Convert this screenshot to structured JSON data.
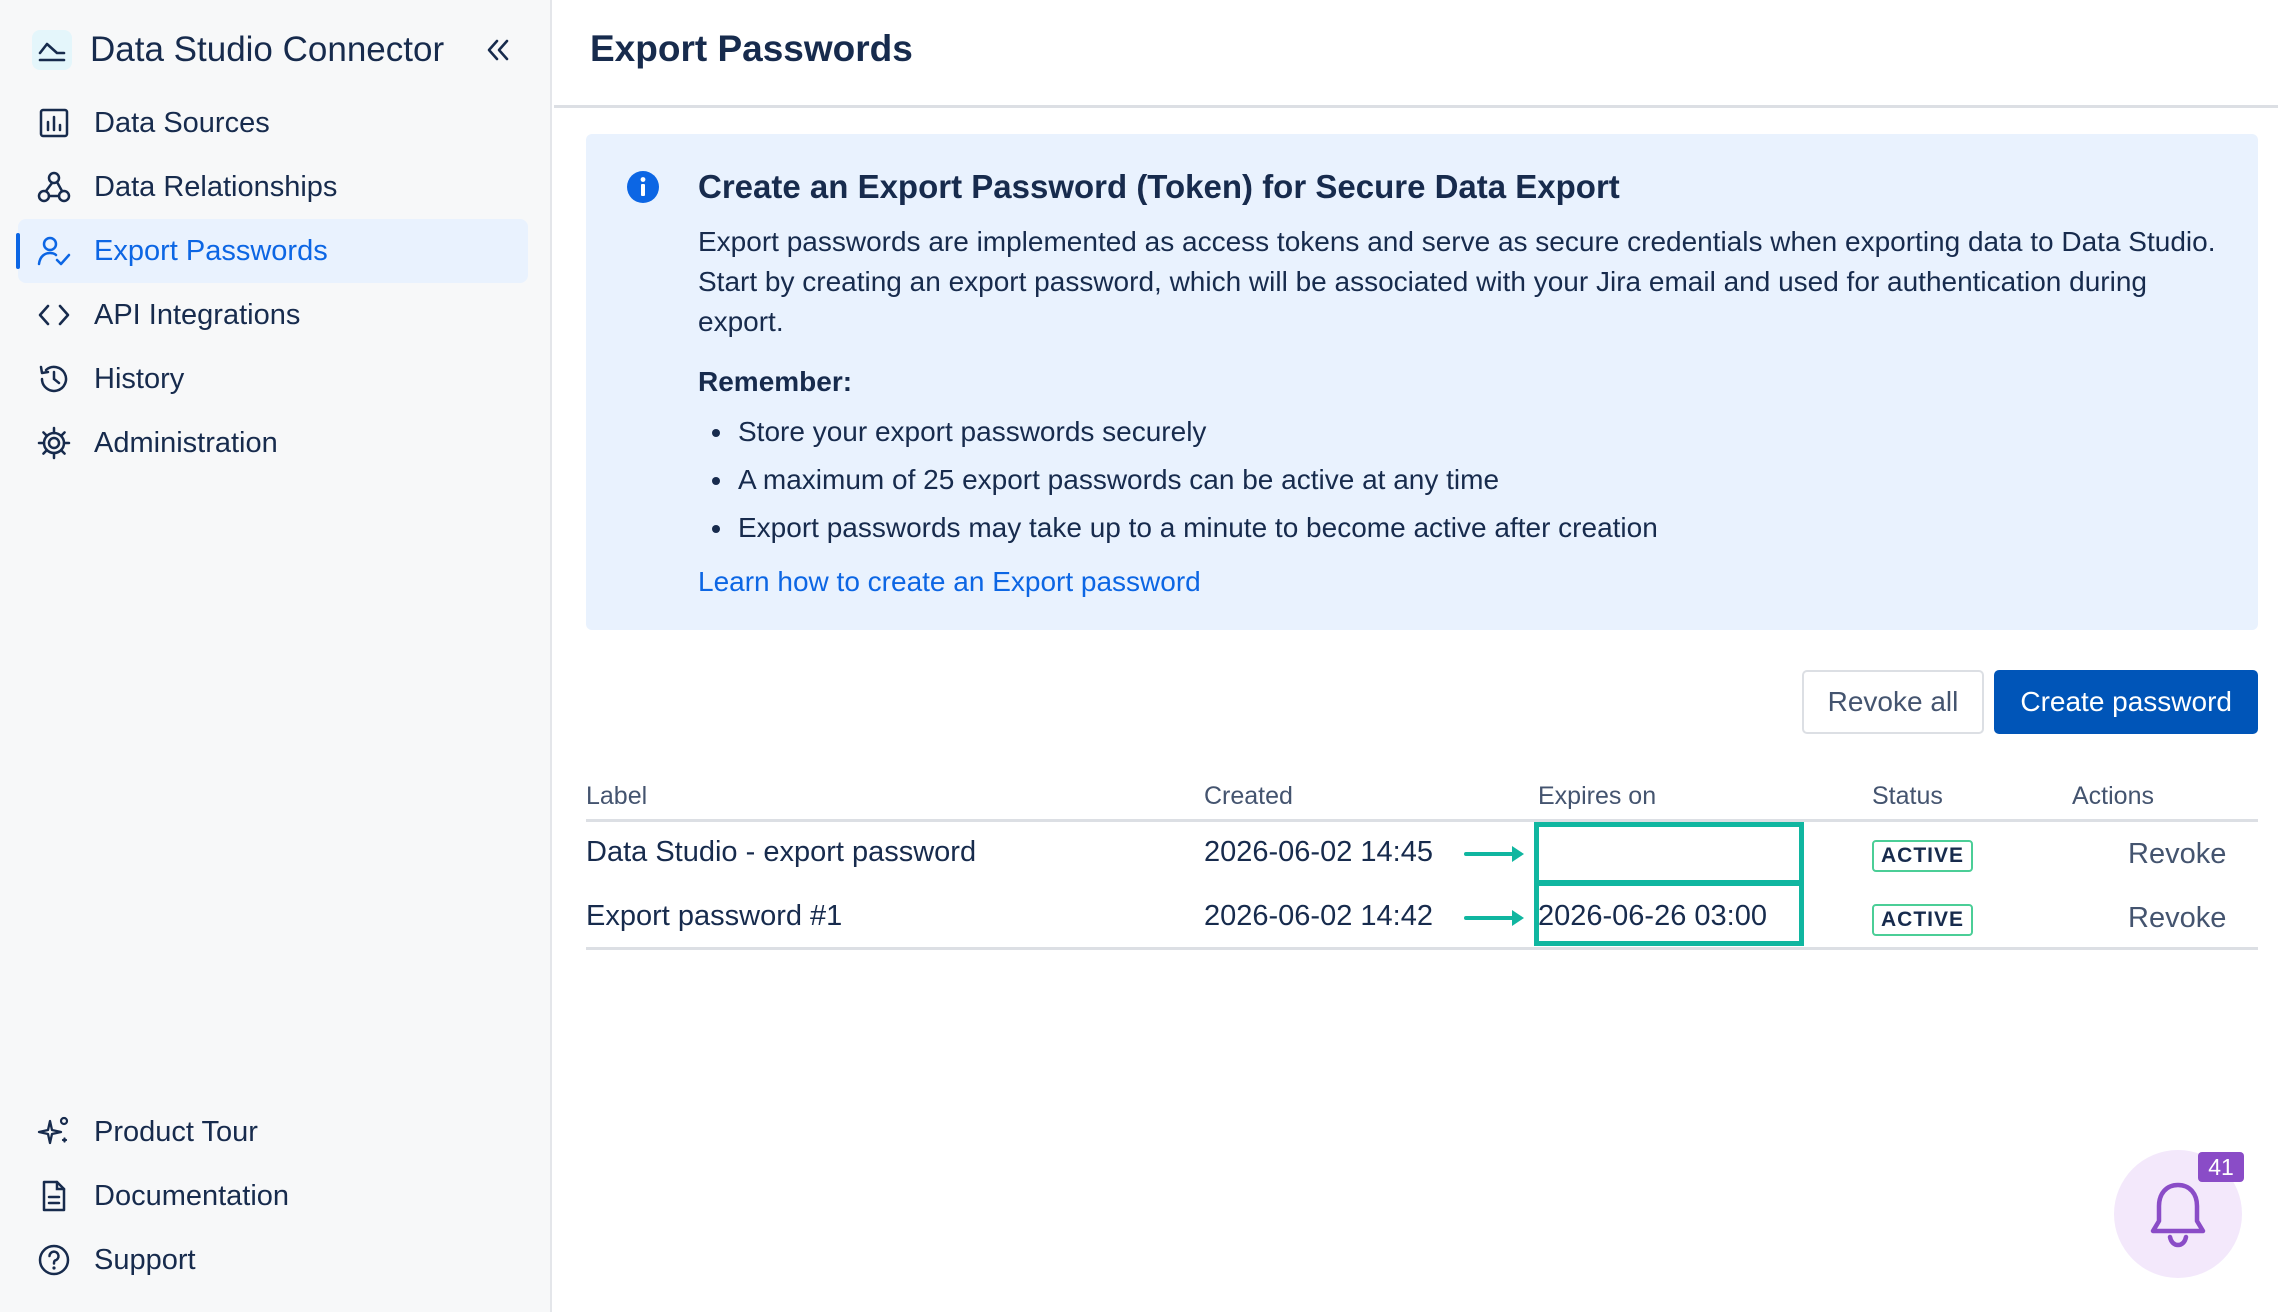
{
  "sidebar": {
    "app_title": "Data Studio Connector",
    "items": [
      {
        "label": "Data Sources",
        "icon": "bar-chart-icon",
        "active": false
      },
      {
        "label": "Data Relationships",
        "icon": "webhook-icon",
        "active": false
      },
      {
        "label": "Export Passwords",
        "icon": "user-check-icon",
        "active": true
      },
      {
        "label": "API Integrations",
        "icon": "code-icon",
        "active": false
      },
      {
        "label": "History",
        "icon": "history-icon",
        "active": false
      },
      {
        "label": "Administration",
        "icon": "gear-icon",
        "active": false
      }
    ],
    "bottom_items": [
      {
        "label": "Product Tour",
        "icon": "sparkle-icon"
      },
      {
        "label": "Documentation",
        "icon": "document-icon"
      },
      {
        "label": "Support",
        "icon": "help-icon"
      }
    ]
  },
  "header": {
    "title": "Export Passwords"
  },
  "info": {
    "heading": "Create an Export Password (Token) for Secure Data Export",
    "description": "Export passwords are implemented as access tokens and serve as secure credentials when exporting data to Data Studio. Start by creating an export password, which will be associated with your Jira email and used for authentication during export.",
    "remember_label": "Remember:",
    "bullets": [
      "Store your export passwords securely",
      "A maximum of 25 export passwords can be active at any time",
      "Export passwords may take up to a minute to become active after creation"
    ],
    "link": "Learn how to create an Export password"
  },
  "actions": {
    "revoke_all": "Revoke all",
    "create": "Create password"
  },
  "table": {
    "columns": {
      "label": "Label",
      "created": "Created",
      "expires": "Expires on",
      "status": "Status",
      "actions": "Actions"
    },
    "rows": [
      {
        "label": "Data Studio - export password",
        "created": "2026-06-02 14:45",
        "expires": "",
        "status": "ACTIVE",
        "action": "Revoke"
      },
      {
        "label": "Export password #1",
        "created": "2026-06-02 14:42",
        "expires": "2026-06-26 03:00",
        "status": "ACTIVE",
        "action": "Revoke"
      }
    ]
  },
  "notifications": {
    "count": "41"
  },
  "colors": {
    "primary": "#0055b8",
    "link": "#0c66e4",
    "info_bg": "#e9f2fe",
    "highlight": "#10b6a0",
    "badge_border": "#4bce97",
    "notification": "#8a4cc7"
  }
}
